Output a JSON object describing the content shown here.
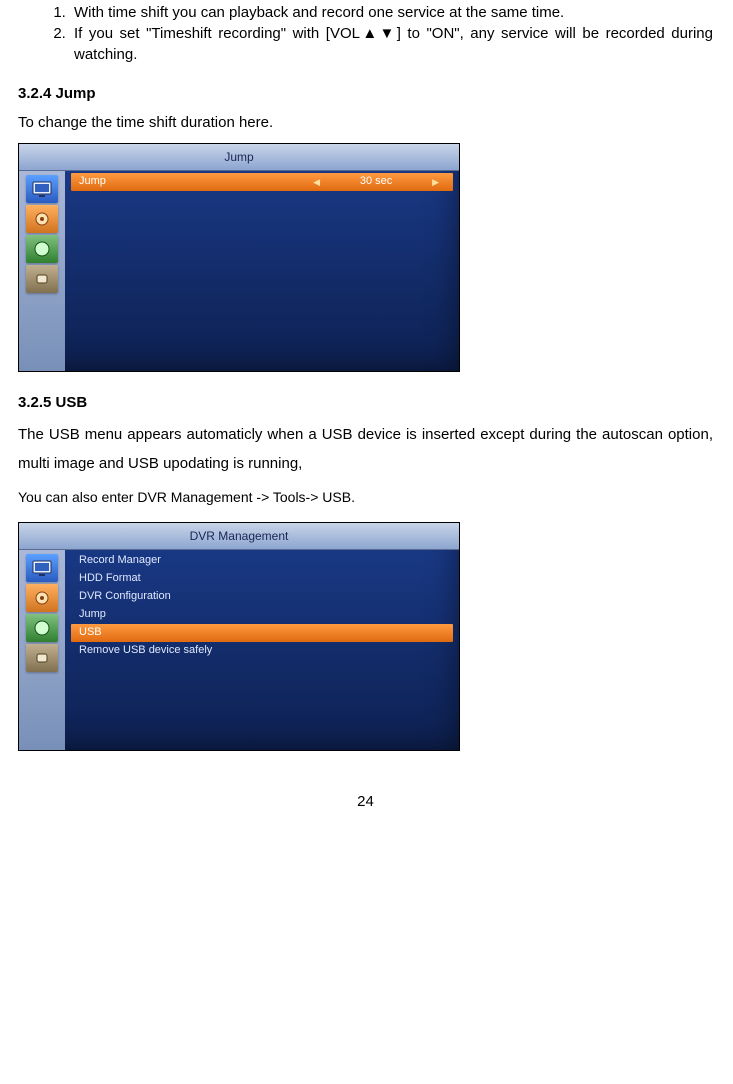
{
  "list": {
    "item1": "With time shift you can playback and record one service at the same time.",
    "item2": "If you set \"Timeshift recording\" with [VOL▲▼] to \"ON\", any service will be recorded during watching."
  },
  "section324": {
    "heading": "3.2.4    Jump",
    "body": "To change the time shift duration here."
  },
  "screenshot1": {
    "title": "Jump",
    "row_label": "Jump",
    "row_value": "30 sec"
  },
  "section325": {
    "heading": "3.2.5    USB",
    "body1": "The USB menu appears automaticly when a USB device is inserted except during the autoscan option, multi image and USB upodating is running,",
    "body2": "You can also enter DVR Management -> Tools-> USB."
  },
  "screenshot2": {
    "title": "DVR Management",
    "items": {
      "i0": "Record Manager",
      "i1": "HDD Format",
      "i2": "DVR Configuration",
      "i3": "Jump",
      "i4": "USB",
      "i5": "Remove USB device safely"
    }
  },
  "page_number": "24"
}
